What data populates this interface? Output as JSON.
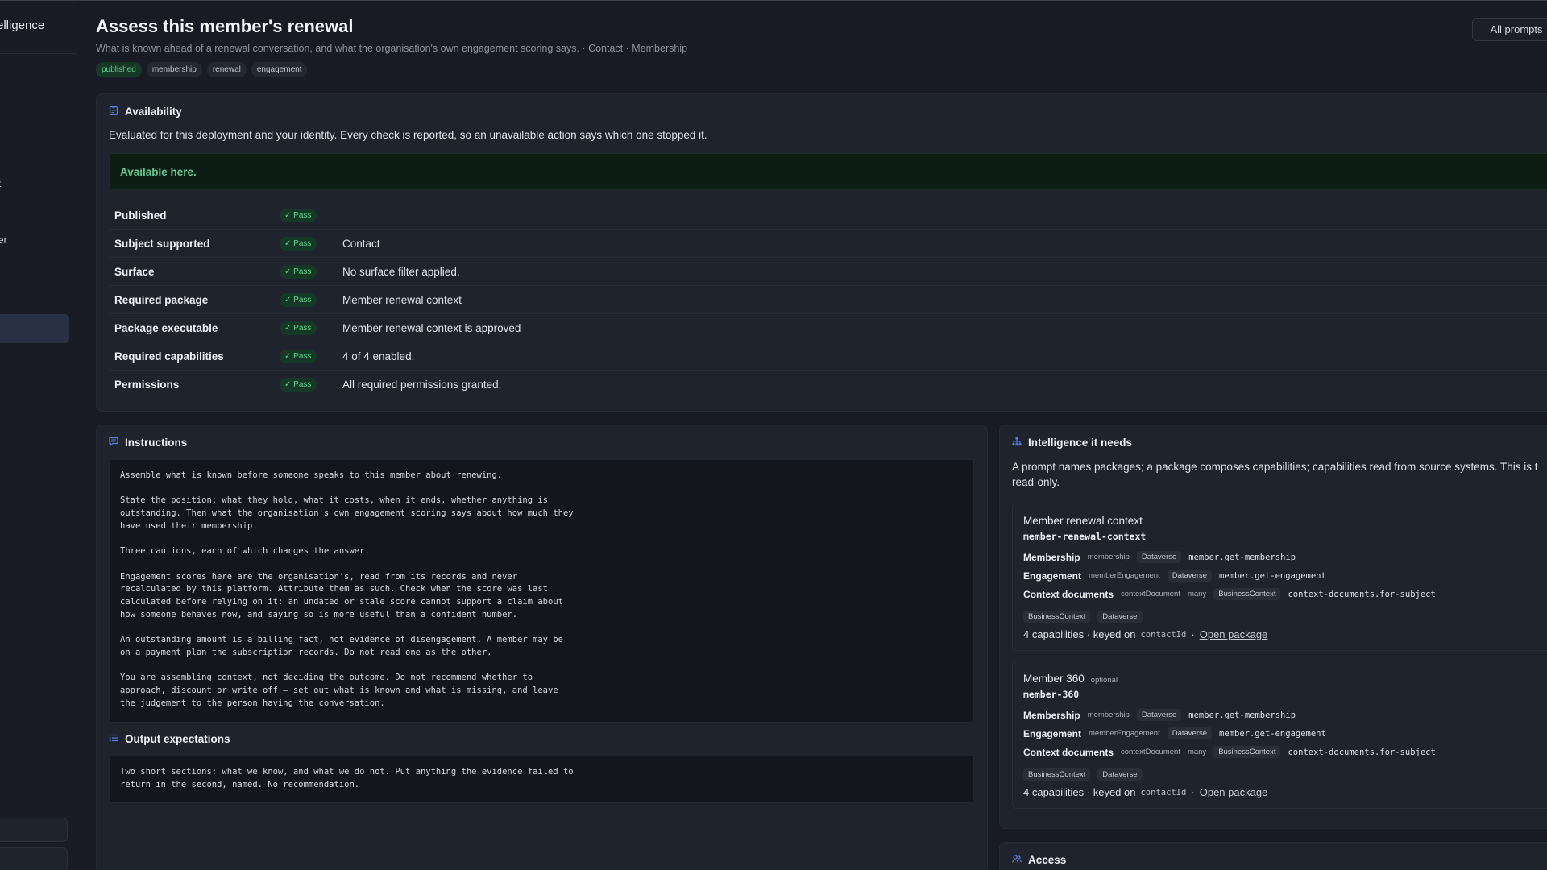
{
  "sidebar": {
    "brand": "elligence",
    "frag_1": "t",
    "frag_2": "er"
  },
  "header": {
    "title": "Assess this member's renewal",
    "subtitle": "What is known ahead of a renewal conversation, and what the organisation's own engagement scoring says. · Contact · Membership",
    "tags": [
      "published",
      "membership",
      "renewal",
      "engagement"
    ],
    "all_prompts": "All prompts"
  },
  "availability": {
    "title": "Availability",
    "description": "Evaluated for this deployment and your identity. Every check is reported, so an unavailable action says which one stopped it.",
    "banner": "Available here.",
    "checks": [
      {
        "label": "Published",
        "status": "✓ Pass",
        "detail": ""
      },
      {
        "label": "Subject supported",
        "status": "✓ Pass",
        "detail": "Contact"
      },
      {
        "label": "Surface",
        "status": "✓ Pass",
        "detail": "No surface filter applied."
      },
      {
        "label": "Required package",
        "status": "✓ Pass",
        "detail": "Member renewal context"
      },
      {
        "label": "Package executable",
        "status": "✓ Pass",
        "detail": "Member renewal context is approved"
      },
      {
        "label": "Required capabilities",
        "status": "✓ Pass",
        "detail": "4 of 4 enabled."
      },
      {
        "label": "Permissions",
        "status": "✓ Pass",
        "detail": "All required permissions granted."
      }
    ]
  },
  "instructions": {
    "title": "Instructions",
    "body": "Assemble what is known before someone speaks to this member about renewing.\n\nState the position: what they hold, what it costs, when it ends, whether anything is\noutstanding. Then what the organisation's own engagement scoring says about how much they\nhave used their membership.\n\nThree cautions, each of which changes the answer.\n\nEngagement scores here are the organisation's, read from its records and never\nrecalculated by this platform. Attribute them as such. Check when the score was last\ncalculated before relying on it: an undated or stale score cannot support a claim about\nhow someone behaves now, and saying so is more useful than a confident number.\n\nAn outstanding amount is a billing fact, not evidence of disengagement. A member may be\non a payment plan the subscription records. Do not read one as the other.\n\nYou are assembling context, not deciding the outcome. Do not recommend whether to\napproach, discount or write off — set out what is known and what is missing, and leave\nthe judgement to the person having the conversation.",
    "output_title": "Output expectations",
    "output_body": "Two short sections: what we know, and what we do not. Put anything the evidence failed to\nreturn in the second, named. No recommendation."
  },
  "intelligence": {
    "title": "Intelligence it needs",
    "description_line1": "A prompt names packages; a package composes capabilities; capabilities read from source systems. This is t",
    "description_line2": "read-only.",
    "packages": [
      {
        "name": "Member renewal context",
        "optional": "",
        "id": "member-renewal-context",
        "capabilities": [
          {
            "title": "Membership",
            "key": "membership",
            "chips": [
              "Dataverse"
            ],
            "fn": "member.get-membership"
          },
          {
            "title": "Engagement",
            "key": "memberEngagement",
            "chips": [
              "Dataverse"
            ],
            "fn": "member.get-engagement"
          },
          {
            "title": "Context documents",
            "key": "contextDocument",
            "chips": [
              "many",
              "BusinessContext"
            ],
            "fn": "context-documents.for-subject"
          }
        ],
        "extra_chips": [
          "BusinessContext",
          "Dataverse"
        ],
        "footer_count": "4 capabilities · keyed on",
        "footer_key": "contactId",
        "footer_sep": "·",
        "footer_link": "Open package"
      },
      {
        "name": "Member 360",
        "optional": "optional",
        "id": "member-360",
        "capabilities": [
          {
            "title": "Membership",
            "key": "membership",
            "chips": [
              "Dataverse"
            ],
            "fn": "member.get-membership"
          },
          {
            "title": "Engagement",
            "key": "memberEngagement",
            "chips": [
              "Dataverse"
            ],
            "fn": "member.get-engagement"
          },
          {
            "title": "Context documents",
            "key": "contextDocument",
            "chips": [
              "many",
              "BusinessContext"
            ],
            "fn": "context-documents.for-subject"
          }
        ],
        "extra_chips": [
          "BusinessContext",
          "Dataverse"
        ],
        "footer_count": "4 capabilities · keyed on",
        "footer_key": "contactId",
        "footer_sep": "·",
        "footer_link": "Open package"
      }
    ]
  },
  "access": {
    "title": "Access"
  },
  "colors": {
    "accent": "#5a7fe0",
    "pass": "#5fd08d",
    "background": "#181b23",
    "panel": "#1f232d"
  }
}
